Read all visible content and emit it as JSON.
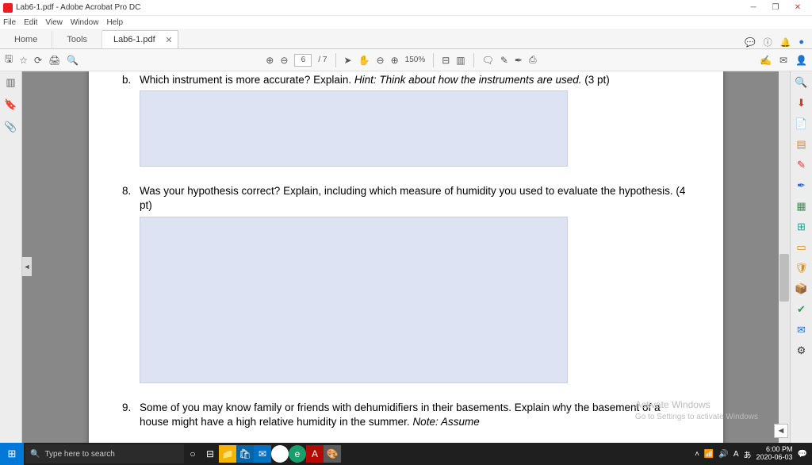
{
  "title": "Lab6-1.pdf - Adobe Acrobat Pro DC",
  "menus": {
    "file": "File",
    "edit": "Edit",
    "view": "View",
    "window": "Window",
    "help": "Help"
  },
  "tabs": {
    "home": "Home",
    "tools": "Tools",
    "doc": "Lab6-1.pdf"
  },
  "toolbar": {
    "page_cur": "6",
    "page_total": "/ 7",
    "zoom": "150%"
  },
  "doc": {
    "qb_label": "b.",
    "qb_text": "Which instrument is more accurate? Explain. ",
    "qb_hint": "Hint: Think about how the instruments are used.",
    "qb_pts": " (3 pt)",
    "q8_label": "8.",
    "q8_text": "Was your hypothesis correct? Explain, including which measure of humidity you used to evaluate the hypothesis. (4 pt)",
    "q9_label": "9.",
    "q9_text": "Some of you may know family or friends with dehumidifiers in their basements. Explain why the basement of a house might have a high relative humidity in the summer. ",
    "q9_note": "Note: Assume"
  },
  "watermark": {
    "l1": "Activate Windows",
    "l2": "Go to Settings to activate Windows"
  },
  "taskbar": {
    "search_placeholder": "Type here to search",
    "time": "6:00 PM",
    "date": "2020-06-03",
    "vol": "🔊",
    "net": "📶",
    "lang": "A",
    "ime": "あ"
  }
}
